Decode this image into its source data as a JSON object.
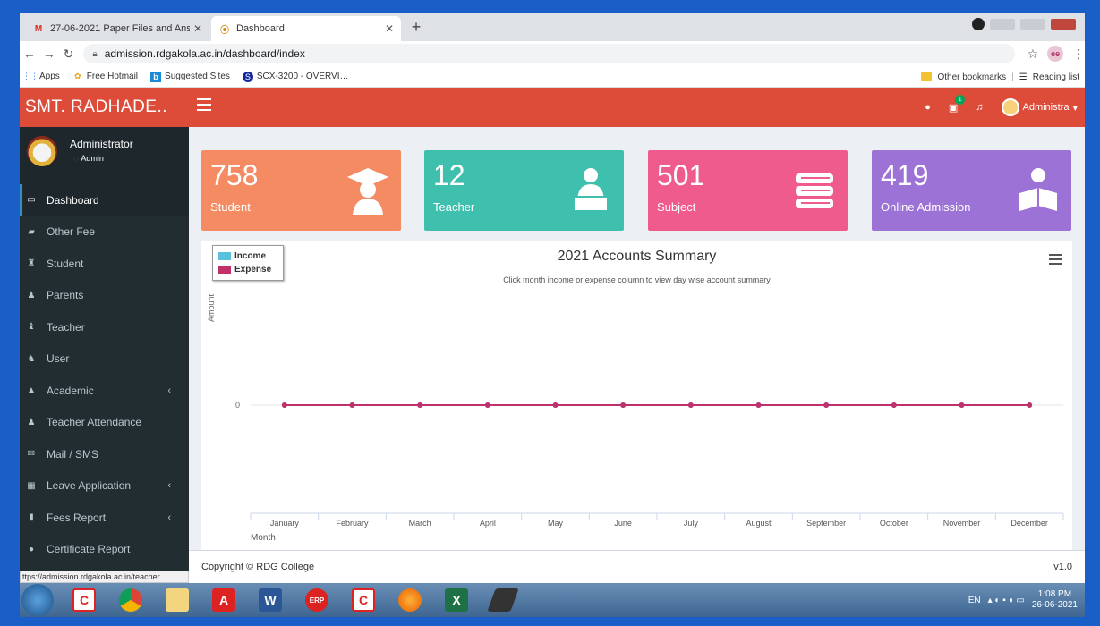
{
  "browser": {
    "tabs": [
      {
        "title": "27-06-2021 Paper Files and Ans…",
        "icon": "gmail-icon"
      },
      {
        "title": "Dashboard",
        "icon": "college-logo-icon"
      }
    ],
    "new_tab": "+",
    "url": "admission.rdgakola.ac.in/dashboard/index",
    "bookmarks": [
      {
        "label": "Apps",
        "icon": "apps-grid-icon"
      },
      {
        "label": "Free Hotmail",
        "icon": "msn-butterfly-icon"
      },
      {
        "label": "Suggested Sites",
        "icon": "bing-icon"
      },
      {
        "label": "SCX-3200 - OVERVI…",
        "icon": "samsung-icon"
      }
    ],
    "other_bookmarks": "Other bookmarks",
    "reading_list": "Reading list",
    "profile_initials": "ee"
  },
  "header": {
    "brand": "SMT. RADHADE..",
    "user_label": "Administra",
    "notification_badge": "1"
  },
  "sidebar": {
    "user_name": "Administrator",
    "user_role": "Admin",
    "items": [
      {
        "label": "Dashboard",
        "icon": "monitor-icon",
        "active": true,
        "caret": ""
      },
      {
        "label": "Other Fee",
        "icon": "money-icon",
        "active": false,
        "caret": ""
      },
      {
        "label": "Student",
        "icon": "graduate-icon",
        "active": false,
        "caret": ""
      },
      {
        "label": "Parents",
        "icon": "user-icon",
        "active": false,
        "caret": ""
      },
      {
        "label": "Teacher",
        "icon": "teacher-icon",
        "active": false,
        "caret": ""
      },
      {
        "label": "User",
        "icon": "users-icon",
        "active": false,
        "caret": ""
      },
      {
        "label": "Academic",
        "icon": "academic-icon",
        "active": false,
        "caret": "‹"
      },
      {
        "label": "Teacher Attendance",
        "icon": "user-check-icon",
        "active": false,
        "caret": ""
      },
      {
        "label": "Mail / SMS",
        "icon": "mail-icon",
        "active": false,
        "caret": ""
      },
      {
        "label": "Leave Application",
        "icon": "calendar-icon",
        "active": false,
        "caret": "‹"
      },
      {
        "label": "Fees Report",
        "icon": "report-icon",
        "active": false,
        "caret": "‹"
      },
      {
        "label": "Certificate Report",
        "icon": "circle-icon",
        "active": false,
        "caret": ""
      }
    ]
  },
  "cards": [
    {
      "value": "758",
      "label": "Student",
      "color": "#f58b62",
      "icon": "graduate-icon"
    },
    {
      "value": "12",
      "label": "Teacher",
      "color": "#3fbfad",
      "icon": "teacher-laptop-icon"
    },
    {
      "value": "501",
      "label": "Subject",
      "color": "#ee5b8c",
      "icon": "books-icon"
    },
    {
      "value": "419",
      "label": "Online Admission",
      "color": "#9d72d6",
      "icon": "reader-icon"
    }
  ],
  "chart_data": {
    "type": "line",
    "title": "2021 Accounts Summary",
    "subtitle": "Click month income or expense column to view day wise account summary",
    "xlabel": "Month",
    "ylabel": "Amount",
    "categories": [
      "January",
      "February",
      "March",
      "April",
      "May",
      "June",
      "July",
      "August",
      "September",
      "October",
      "November",
      "December"
    ],
    "series": [
      {
        "name": "Income",
        "color": "#5bc0de",
        "values": [
          0,
          0,
          0,
          0,
          0,
          0,
          0,
          0,
          0,
          0,
          0,
          0
        ]
      },
      {
        "name": "Expense",
        "color": "#c0306b",
        "values": [
          0,
          0,
          0,
          0,
          0,
          0,
          0,
          0,
          0,
          0,
          0,
          0
        ]
      }
    ],
    "yticks": [
      "0"
    ],
    "legend": "top-left",
    "grid": true
  },
  "footer": {
    "copyright": "Copyright © RDG College",
    "version": "v1.0"
  },
  "status_url": "ttps://admission.rdgakola.ac.in/teacher",
  "taskbar": {
    "lang": "EN",
    "time": "1:08 PM",
    "date": "26-06-2021"
  }
}
